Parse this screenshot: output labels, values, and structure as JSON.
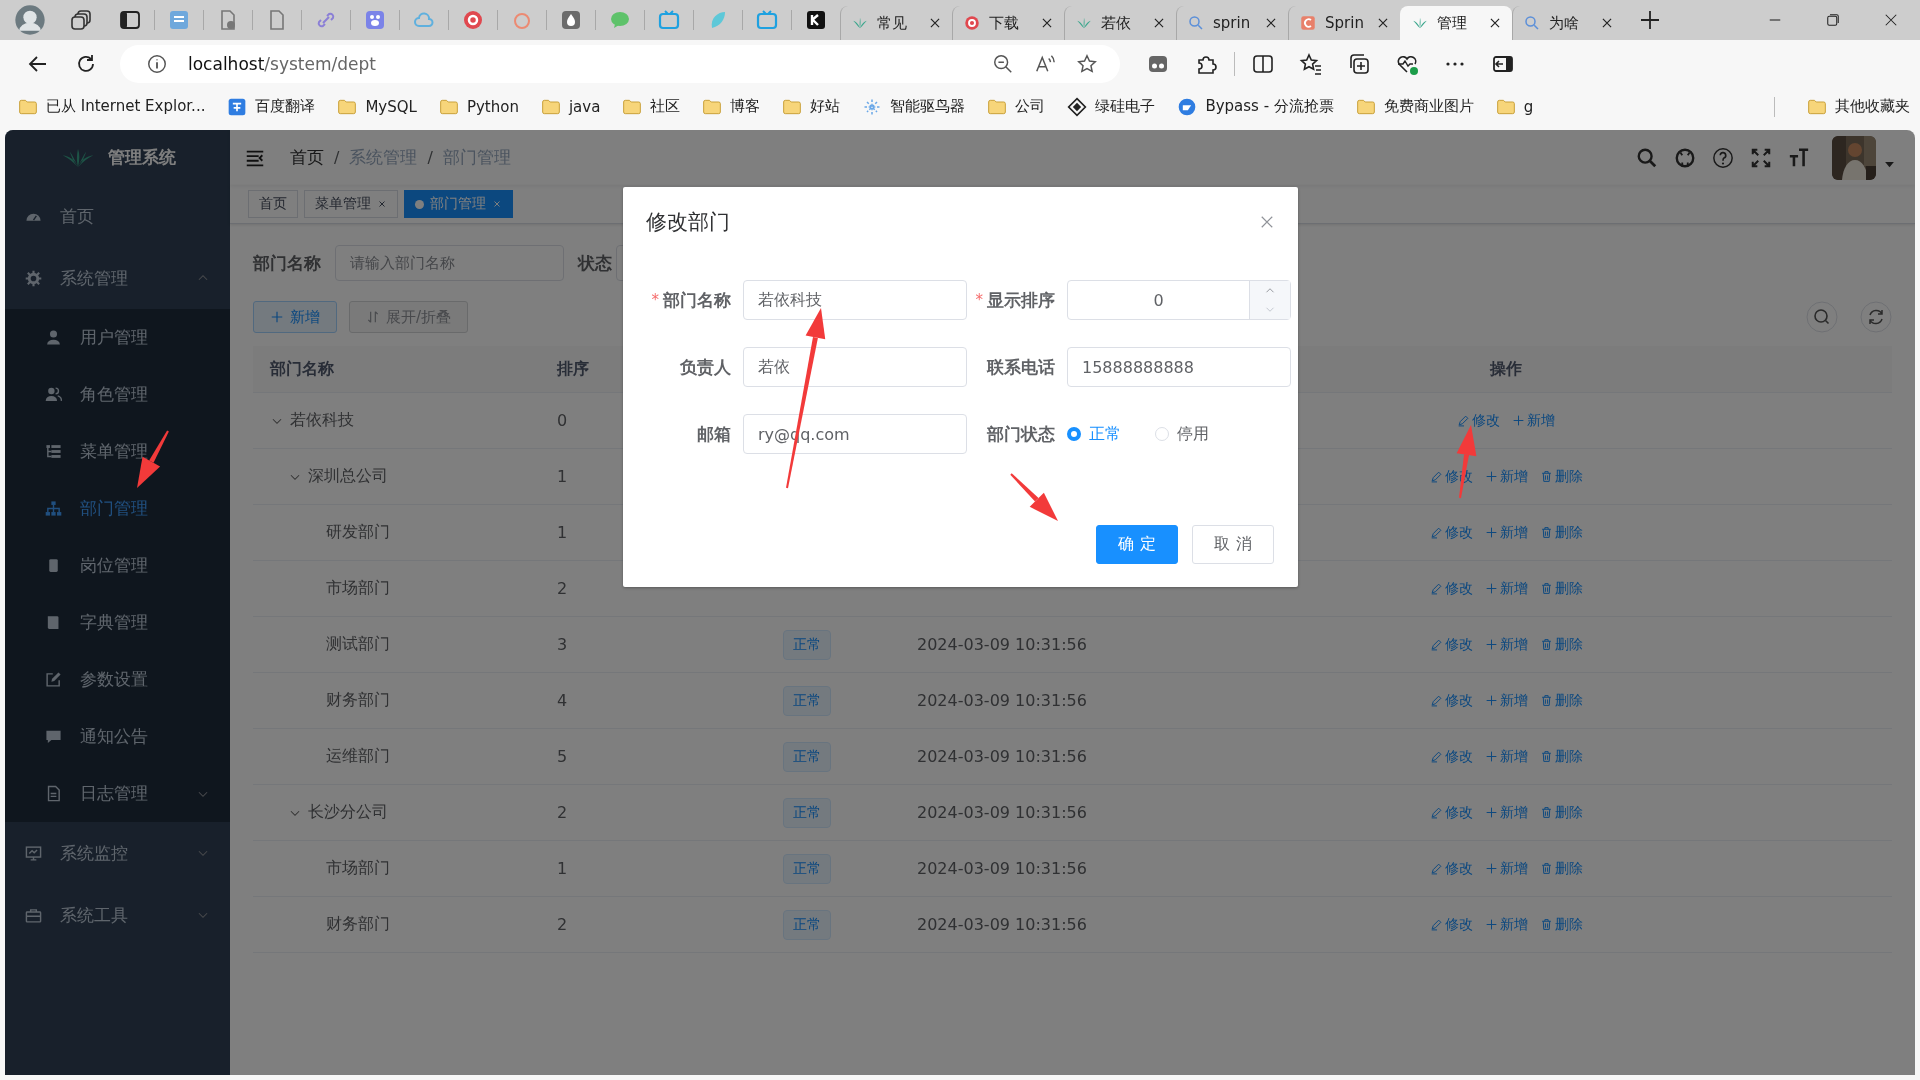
{
  "browser": {
    "tabs": [
      {
        "kind": "leaf",
        "title": "常见",
        "selected": false
      },
      {
        "kind": "circle",
        "title": "下载",
        "selected": false
      },
      {
        "kind": "leaf",
        "title": "若依",
        "selected": false
      },
      {
        "kind": "search",
        "title": "sprin",
        "selected": false
      },
      {
        "kind": "square",
        "title": "Sprin",
        "selected": false
      },
      {
        "kind": "leaf",
        "title": "管理",
        "selected": true
      },
      {
        "kind": "search",
        "title": "为啥",
        "selected": false
      }
    ],
    "address": {
      "host": "localhost",
      "path": "/system/dept"
    },
    "bookmarks": [
      {
        "kind": "folder",
        "label": "已从 Internet Explor..."
      },
      {
        "kind": "translate",
        "label": "百度翻译"
      },
      {
        "kind": "folder",
        "label": "MySQL"
      },
      {
        "kind": "folder",
        "label": "Python"
      },
      {
        "kind": "folder",
        "label": "java"
      },
      {
        "kind": "folder",
        "label": "社区"
      },
      {
        "kind": "folder",
        "label": "博客"
      },
      {
        "kind": "folder",
        "label": "好站"
      },
      {
        "kind": "sparkle",
        "label": "智能驱鸟器"
      },
      {
        "kind": "folder",
        "label": "公司"
      },
      {
        "kind": "diamond",
        "label": "绿硅电子"
      },
      {
        "kind": "globe",
        "label": "Bypass - 分流抢票"
      },
      {
        "kind": "folder",
        "label": "免费商业图片"
      },
      {
        "kind": "folder",
        "label": "g"
      }
    ],
    "other_bookmarks": {
      "kind": "folder",
      "label": "其他收藏夹"
    }
  },
  "app": {
    "logo_title": "管理系统",
    "menu": [
      {
        "label": "首页",
        "selected": false
      },
      {
        "label": "系统管理",
        "selected": false,
        "expanded": true,
        "children": [
          {
            "label": "用户管理",
            "selected": false
          },
          {
            "label": "角色管理",
            "selected": false
          },
          {
            "label": "菜单管理",
            "selected": false
          },
          {
            "label": "部门管理",
            "selected": true
          },
          {
            "label": "岗位管理",
            "selected": false
          },
          {
            "label": "字典管理",
            "selected": false
          },
          {
            "label": "参数设置",
            "selected": false
          },
          {
            "label": "通知公告",
            "selected": false
          },
          {
            "label": "日志管理",
            "selected": false,
            "expanded": false
          }
        ]
      },
      {
        "label": "系统监控",
        "selected": false,
        "expanded": false
      },
      {
        "label": "系统工具",
        "selected": false,
        "expanded": false
      }
    ],
    "breadcrumb": [
      {
        "label": "首页",
        "link": true
      },
      {
        "separator": "/",
        "label": "系统管理",
        "link": false
      },
      {
        "separator": "/",
        "label": "部门管理",
        "link": false
      }
    ],
    "tags": [
      {
        "label": "首页",
        "closable": false,
        "selected": false
      },
      {
        "label": "菜单管理",
        "closable": true,
        "selected": false
      },
      {
        "label": "部门管理",
        "closable": true,
        "selected": true
      }
    ],
    "search": {
      "name_label": "部门名称",
      "name_placeholder": "请输入部门名称",
      "status_label": "状态"
    },
    "toolbar": [
      {
        "kind": "primary",
        "label": "新增"
      },
      {
        "kind": "plain",
        "label": "展开/折叠"
      }
    ],
    "table": {
      "header": {
        "name": "部门名称",
        "sort": "排序",
        "actions": "操作"
      },
      "rows": [
        {
          "name": "若依科技",
          "sort": "0",
          "expanded": true,
          "actions": [
            {
              "kind": "edit",
              "label": "修改"
            },
            {
              "kind": "add",
              "label": "新增"
            }
          ],
          "children": [
            {
              "name": "深圳总公司",
              "sort": "1",
              "expanded": true,
              "actions": [
                {
                  "kind": "edit",
                  "label": "修改"
                },
                {
                  "kind": "add",
                  "label": "新增"
                },
                {
                  "kind": "delete",
                  "label": "删除"
                }
              ],
              "children": [
                {
                  "name": "研发部门",
                  "sort": "1",
                  "actions": [
                    {
                      "kind": "edit",
                      "label": "修改"
                    },
                    {
                      "kind": "add",
                      "label": "新增"
                    },
                    {
                      "kind": "delete",
                      "label": "删除"
                    }
                  ]
                },
                {
                  "name": "市场部门",
                  "sort": "2",
                  "actions": [
                    {
                      "kind": "edit",
                      "label": "修改"
                    },
                    {
                      "kind": "add",
                      "label": "新增"
                    },
                    {
                      "kind": "delete",
                      "label": "删除"
                    }
                  ]
                },
                {
                  "name": "测试部门",
                  "sort": "3",
                  "status": "正常",
                  "created": "2024-03-09 10:31:56",
                  "actions": [
                    {
                      "kind": "edit",
                      "label": "修改"
                    },
                    {
                      "kind": "add",
                      "label": "新增"
                    },
                    {
                      "kind": "delete",
                      "label": "删除"
                    }
                  ]
                },
                {
                  "name": "财务部门",
                  "sort": "4",
                  "status": "正常",
                  "created": "2024-03-09 10:31:56",
                  "actions": [
                    {
                      "kind": "edit",
                      "label": "修改"
                    },
                    {
                      "kind": "add",
                      "label": "新增"
                    },
                    {
                      "kind": "delete",
                      "label": "删除"
                    }
                  ]
                },
                {
                  "name": "运维部门",
                  "sort": "5",
                  "status": "正常",
                  "created": "2024-03-09 10:31:56",
                  "actions": [
                    {
                      "kind": "edit",
                      "label": "修改"
                    },
                    {
                      "kind": "add",
                      "label": "新增"
                    },
                    {
                      "kind": "delete",
                      "label": "删除"
                    }
                  ]
                }
              ]
            },
            {
              "name": "长沙分公司",
              "sort": "2",
              "expanded": true,
              "status": "正常",
              "created": "2024-03-09 10:31:56",
              "actions": [
                {
                  "kind": "edit",
                  "label": "修改"
                },
                {
                  "kind": "add",
                  "label": "新增"
                },
                {
                  "kind": "delete",
                  "label": "删除"
                }
              ],
              "children": [
                {
                  "name": "市场部门",
                  "sort": "1",
                  "status": "正常",
                  "created": "2024-03-09 10:31:56",
                  "actions": [
                    {
                      "kind": "edit",
                      "label": "修改"
                    },
                    {
                      "kind": "add",
                      "label": "新增"
                    },
                    {
                      "kind": "delete",
                      "label": "删除"
                    }
                  ]
                },
                {
                  "name": "财务部门",
                  "sort": "2",
                  "status": "正常",
                  "created": "2024-03-09 10:31:56",
                  "actions": [
                    {
                      "kind": "edit",
                      "label": "修改"
                    },
                    {
                      "kind": "add",
                      "label": "新增"
                    },
                    {
                      "kind": "delete",
                      "label": "删除"
                    }
                  ]
                }
              ]
            }
          ]
        }
      ]
    }
  },
  "dialog": {
    "title": "修改部门",
    "fields": [
      {
        "kind": "text",
        "mark": "*",
        "label": "部门名称",
        "value": "若依科技"
      },
      {
        "kind": "number",
        "mark": "*",
        "label": "显示排序",
        "value": "0"
      },
      {
        "kind": "text",
        "label": "负责人",
        "value": "若依"
      },
      {
        "kind": "text",
        "label": "联系电话",
        "value": "15888888888"
      },
      {
        "kind": "text",
        "label": "邮箱",
        "value": "ry@qq.com"
      },
      {
        "kind": "radio",
        "label": "部门状态",
        "options": [
          {
            "label": "正常",
            "selected": true
          },
          {
            "label": "停用",
            "selected": false
          }
        ]
      }
    ],
    "buttons": [
      {
        "kind": "primary",
        "label": "确 定"
      },
      {
        "kind": "plain",
        "label": "取 消"
      }
    ]
  }
}
